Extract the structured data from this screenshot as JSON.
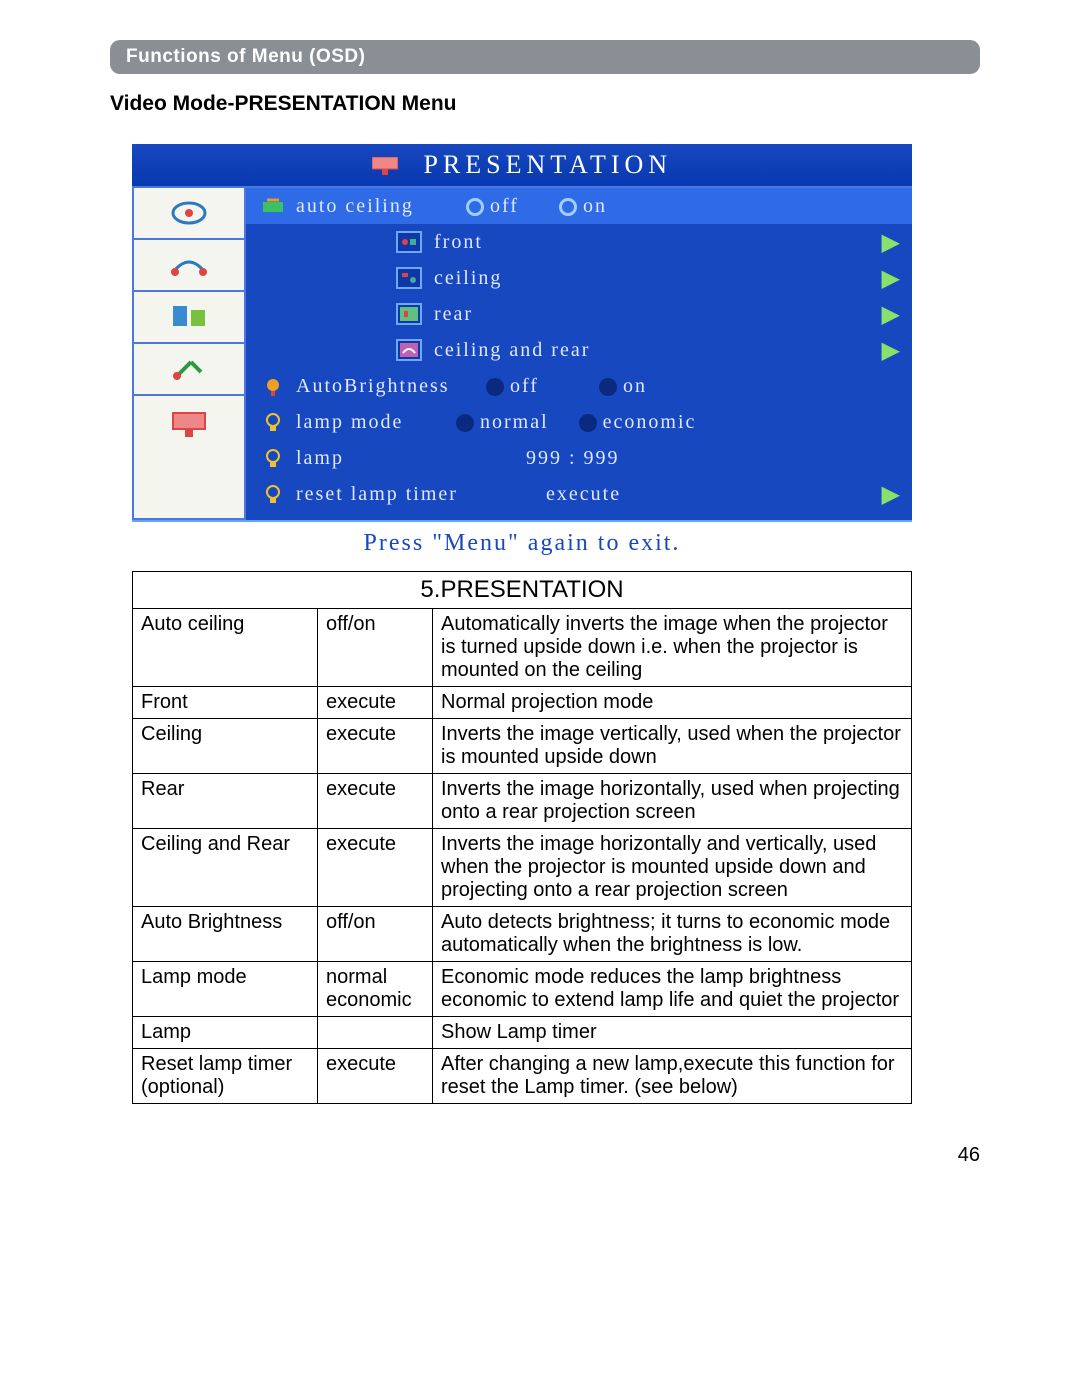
{
  "section_title": "Functions of Menu (OSD)",
  "subheading": "Video Mode-PRESENTATION Menu",
  "page_number": "46",
  "osd": {
    "header": "PRESENTATION",
    "footer": "Press \"Menu\" again to exit.",
    "auto_ceiling": {
      "label": "auto ceiling",
      "off": "off",
      "on": "on"
    },
    "proj": {
      "front": "front",
      "ceiling": "ceiling",
      "rear": "rear",
      "ceiling_rear": "ceiling and rear"
    },
    "auto_brightness": {
      "label": "AutoBrightness",
      "off": "off",
      "on": "on"
    },
    "lamp_mode": {
      "label": "lamp mode",
      "normal": "normal",
      "economic": "economic"
    },
    "lamp": {
      "label": "lamp",
      "value": "999 : 999"
    },
    "reset_lamp": {
      "label": "reset lamp timer",
      "action": "execute"
    }
  },
  "table": {
    "title": "5.PRESENTATION",
    "rows": [
      {
        "name": "Auto ceiling",
        "value": "off/on",
        "desc": "Automatically inverts the image when the projector is turned upside down i.e. when the projector is mounted on the ceiling"
      },
      {
        "name": "Front",
        "value": "execute",
        "desc": "Normal projection mode"
      },
      {
        "name": "Ceiling",
        "value": "execute",
        "desc": "Inverts the image vertically, used when the projector is mounted upside down"
      },
      {
        "name": "Rear",
        "value": "execute",
        "desc": "Inverts the image horizontally, used when projecting onto a rear projection screen"
      },
      {
        "name": "Ceiling and Rear",
        "value": "execute",
        "desc": "Inverts the image horizontally and vertically, used when the projector is mounted upside down and projecting onto a rear projection screen",
        "justify": true
      },
      {
        "name": "Auto Brightness",
        "value": "off/on",
        "desc": "Auto detects brightness; it turns to economic mode automatically when the brightness is low.",
        "justify": true
      },
      {
        "name": "Lamp mode",
        "value": "normal economic",
        "desc": "Economic mode reduces the lamp brightness economic to extend lamp life and quiet the projector"
      },
      {
        "name": "Lamp",
        "value": "",
        "desc": "Show Lamp timer"
      },
      {
        "name": "Reset lamp timer (optional)",
        "value": "execute",
        "desc": "After changing a new lamp,execute this function for reset the Lamp timer. (see below)"
      }
    ]
  }
}
